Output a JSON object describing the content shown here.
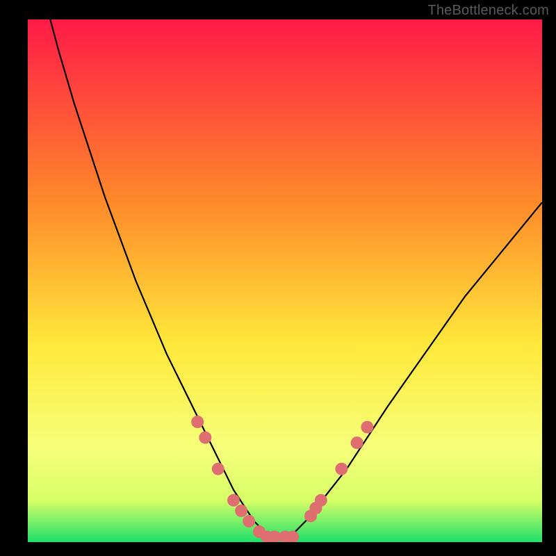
{
  "watermark": "TheBottleneck.com",
  "colors": {
    "page_bg": "#000000",
    "gradient_top": "#ff1a48",
    "gradient_mid1": "#ff8a2a",
    "gradient_mid2": "#ffe83a",
    "gradient_mid3": "#f6ff7a",
    "gradient_bottom": "#1fe06a",
    "curve": "#000000",
    "marker_fill": "#de6e70",
    "marker_stroke": "#b94d4f"
  },
  "chart_data": {
    "type": "line",
    "title": "",
    "xlabel": "",
    "ylabel": "",
    "xlim": [
      0,
      100
    ],
    "ylim": [
      0,
      100
    ],
    "grid": false,
    "legend": false,
    "series": [
      {
        "name": "bottleneck-curve",
        "x": [
          0,
          3,
          6,
          9,
          12,
          15,
          18,
          21,
          24,
          27,
          30,
          33,
          36,
          38,
          40,
          42,
          44,
          46,
          48,
          50,
          52,
          55,
          58,
          62,
          66,
          70,
          75,
          80,
          85,
          90,
          95,
          100
        ],
        "y": [
          118,
          105,
          94,
          84,
          75,
          66,
          58,
          50,
          43,
          36,
          30,
          24,
          18,
          14,
          10,
          7,
          4,
          2,
          1,
          1,
          2,
          5,
          9,
          14,
          20,
          26,
          33,
          40,
          47,
          53,
          59,
          65
        ]
      }
    ],
    "markers": {
      "name": "highlight-points",
      "points": [
        {
          "x": 33,
          "y": 23
        },
        {
          "x": 34.5,
          "y": 20
        },
        {
          "x": 37,
          "y": 14
        },
        {
          "x": 40,
          "y": 8
        },
        {
          "x": 41.5,
          "y": 6
        },
        {
          "x": 43,
          "y": 4
        },
        {
          "x": 45,
          "y": 2
        },
        {
          "x": 46.5,
          "y": 1
        },
        {
          "x": 48,
          "y": 1
        },
        {
          "x": 50,
          "y": 1
        },
        {
          "x": 51.5,
          "y": 1
        },
        {
          "x": 55,
          "y": 5
        },
        {
          "x": 56,
          "y": 6.5
        },
        {
          "x": 57,
          "y": 8
        },
        {
          "x": 61,
          "y": 14
        },
        {
          "x": 64,
          "y": 19
        },
        {
          "x": 66,
          "y": 22
        }
      ]
    },
    "gradient_stops": [
      {
        "offset": 0.0,
        "color": "#ff1a48"
      },
      {
        "offset": 0.35,
        "color": "#ff8a2a"
      },
      {
        "offset": 0.62,
        "color": "#ffe83a"
      },
      {
        "offset": 0.82,
        "color": "#f6ff7a"
      },
      {
        "offset": 0.92,
        "color": "#d7ff66"
      },
      {
        "offset": 1.0,
        "color": "#1fe06a"
      }
    ]
  }
}
